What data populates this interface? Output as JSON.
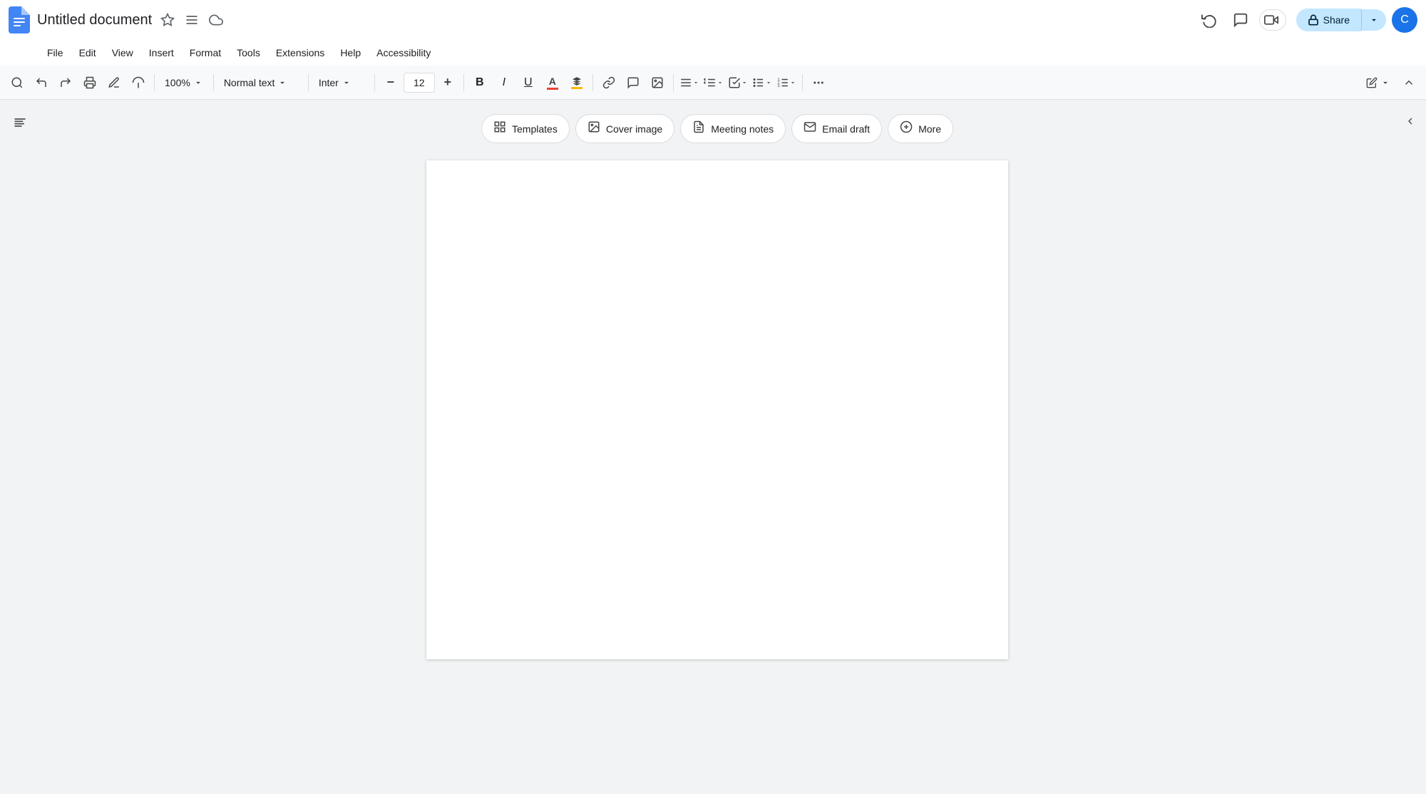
{
  "titleBar": {
    "docTitle": "Untitled document",
    "starIcon": "☆",
    "driveIcon": "⊟",
    "cloudIcon": "☁"
  },
  "titleRight": {
    "historyIcon": "↺",
    "chatIcon": "💬",
    "meetIcon": "📹",
    "meetLabel": "",
    "shareLock": "🔒",
    "shareLabel": "Share",
    "shareDropdown": "▾",
    "avatarInitial": "C"
  },
  "menuBar": {
    "items": [
      "File",
      "Edit",
      "View",
      "Insert",
      "Format",
      "Tools",
      "Extensions",
      "Help",
      "Accessibility"
    ]
  },
  "toolbar": {
    "zoom": "100%",
    "normalText": "Normal text",
    "font": "Inter",
    "fontSizeDecrease": "−",
    "fontSize": "12",
    "fontSizeIncrease": "+",
    "boldLabel": "B",
    "italicLabel": "I",
    "underlineLabel": "U",
    "moreVertical": "⋮"
  },
  "suggestions": {
    "chips": [
      {
        "id": "templates",
        "icon": "⊞",
        "label": "Templates"
      },
      {
        "id": "cover-image",
        "icon": "🖼",
        "label": "Cover image"
      },
      {
        "id": "meeting-notes",
        "icon": "📄",
        "label": "Meeting notes"
      },
      {
        "id": "email-draft",
        "icon": "✉",
        "label": "Email draft"
      },
      {
        "id": "more",
        "icon": "⊕",
        "label": "More"
      }
    ]
  },
  "sidebar": {
    "toggleIcon": "≡",
    "collapseIcon": "❯"
  }
}
